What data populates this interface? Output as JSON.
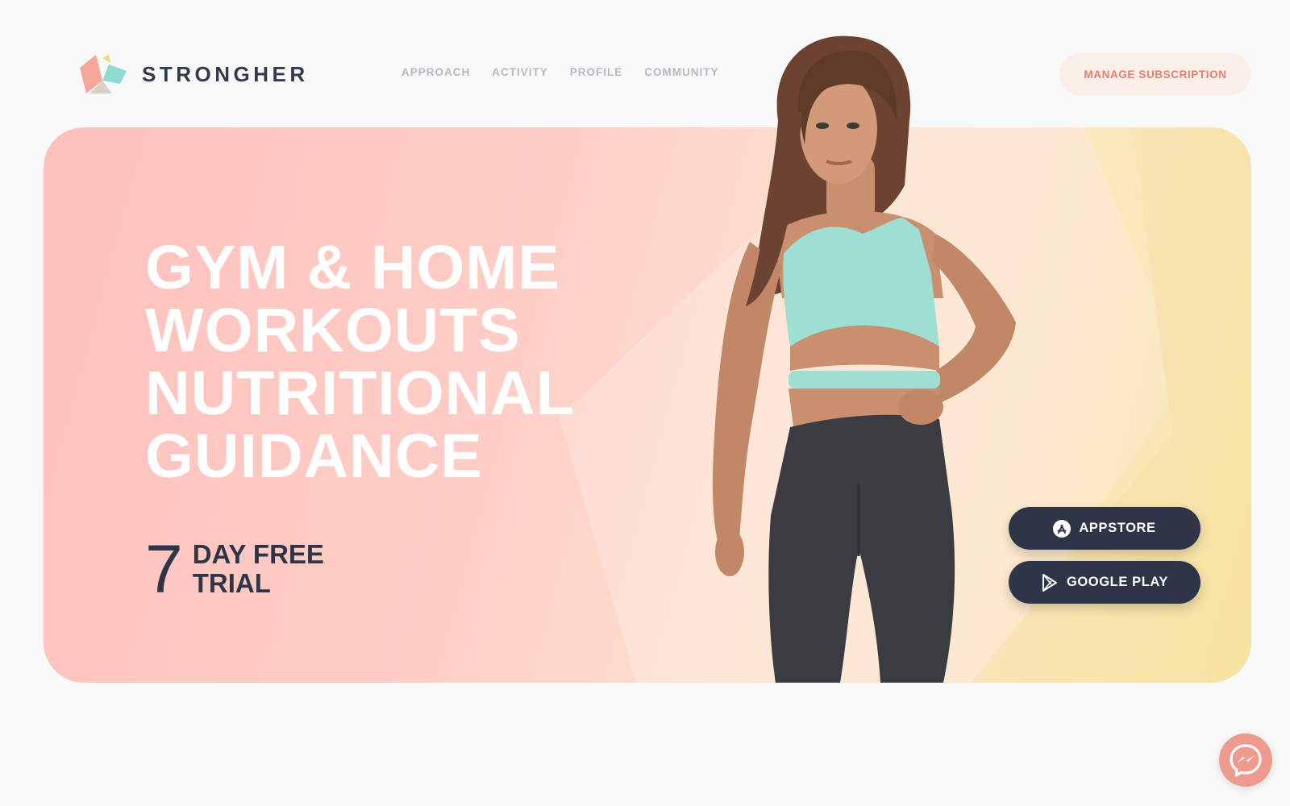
{
  "brand": {
    "name": "STRONGHER",
    "icon": "logo-icon"
  },
  "nav": {
    "items": [
      {
        "label": "APPROACH"
      },
      {
        "label": "ACTIVITY"
      },
      {
        "label": "PROFILE"
      },
      {
        "label": "COMMUNITY"
      }
    ]
  },
  "header": {
    "manage_label": "MANAGE SUBSCRIPTION"
  },
  "hero": {
    "headline": [
      "GYM & HOME",
      "WORKOUTS",
      "NUTRITIONAL",
      "GUIDANCE"
    ],
    "trial": {
      "number": "7",
      "line1": "DAY FREE",
      "line2": "TRIAL"
    },
    "buttons": {
      "appstore": {
        "label": "APPSTORE",
        "icon": "app-store-icon"
      },
      "googleplay": {
        "label": "GOOGLE PLAY",
        "icon": "google-play-icon"
      }
    }
  },
  "chat": {
    "icon": "messenger-icon"
  },
  "colors": {
    "accent": "#e47f6c",
    "dark": "#2e3546",
    "hero_pink": "#fec1bd",
    "hero_yellow": "#f6e19a"
  }
}
